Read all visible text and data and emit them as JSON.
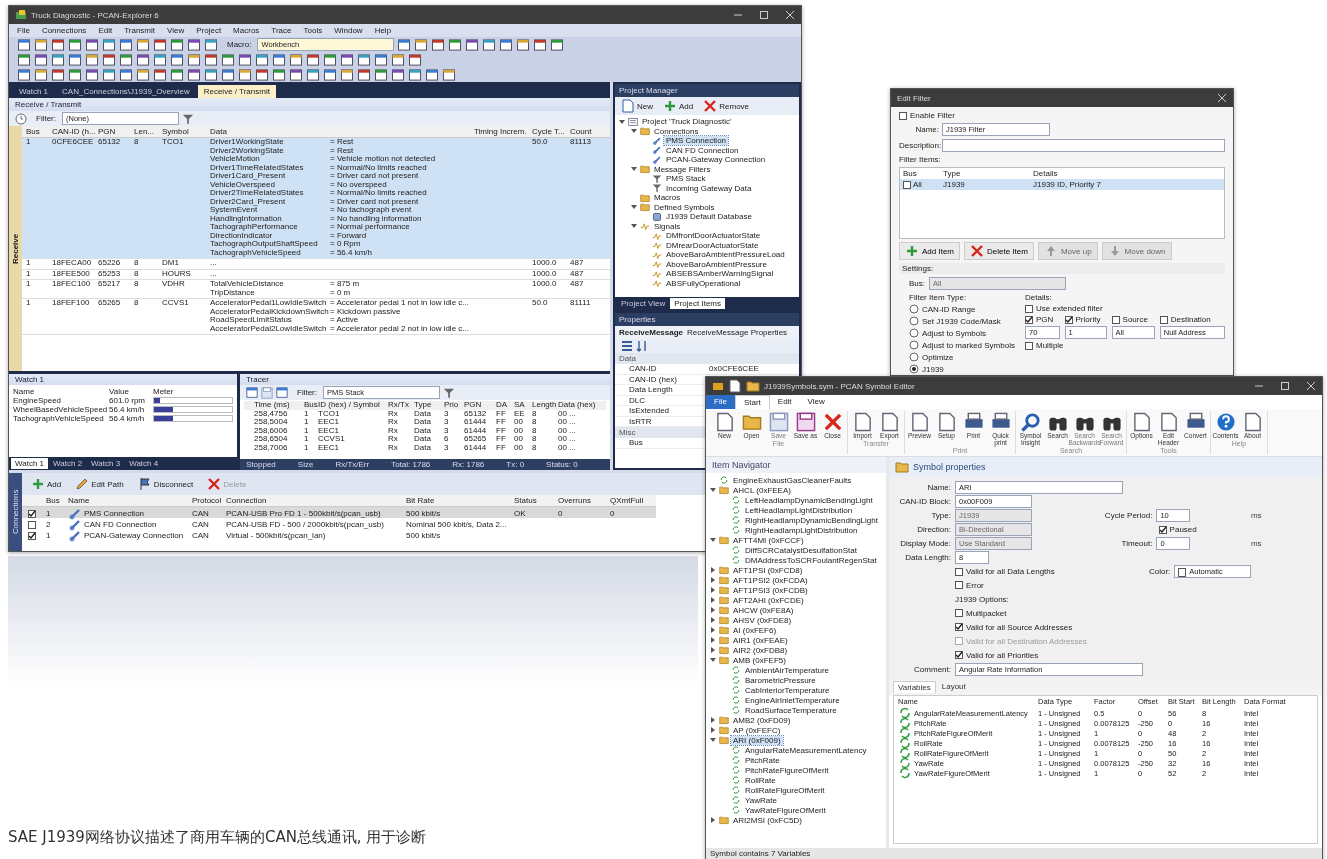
{
  "main_window": {
    "title": "Truck Diagnostic - PCAN-Explorer 6",
    "menu": [
      "File",
      "Connections",
      "Edit",
      "Transmit",
      "View",
      "Project",
      "Macros",
      "Trace",
      "Tools",
      "Window",
      "Help"
    ],
    "toolbar_combo": {
      "label": "Macro:",
      "value": "Workbench"
    },
    "doc_tabs": [
      {
        "label": "Watch 1",
        "selected": false
      },
      {
        "label": "CAN_Connections\\J1939_Overview",
        "selected": false
      },
      {
        "label": "Receive / Transmit",
        "selected": true
      }
    ],
    "receive": {
      "title": "Receive / Transmit",
      "filter_label": "Filter:",
      "filter_value": "(None)",
      "side_label": "Receive",
      "columns": [
        "Bus",
        "CAN-ID (h...",
        "PGN",
        "Len...",
        "Symbol",
        "Data",
        "Timing Increm.",
        "Cycle T...",
        "Count"
      ],
      "rows": [
        {
          "selected": true,
          "cells": [
            "1",
            "0CFE6CEE",
            "65132",
            "8",
            "TCO1"
          ],
          "data": [
            {
              "name": "Driver1WorkingState",
              "value": "= Rest"
            },
            {
              "name": "Driver2WorkingState",
              "value": "= Rest"
            },
            {
              "name": "VehicleMotion",
              "value": "= Vehicle motion not detected"
            },
            {
              "name": "Driver1TimeRelatedStates",
              "value": "= Normal/No limits reached"
            },
            {
              "name": "Driver1Card_Present",
              "value": "= Driver card not present"
            },
            {
              "name": "VehicleOverspeed",
              "value": "= No overspeed"
            },
            {
              "name": "Driver2TimeRelatedStates",
              "value": "= Normal/No limits reached"
            },
            {
              "name": "Driver2Card_Present",
              "value": "= Driver card not present"
            },
            {
              "name": "SystemEvent",
              "value": "= No tachograph event"
            },
            {
              "name": "HandlingInformation",
              "value": "= No handling information"
            },
            {
              "name": "TachographPerformance",
              "value": "= Normal performance"
            },
            {
              "name": "DirectionIndicator",
              "value": "= Forward"
            },
            {
              "name": "TachographOutputShaftSpeed",
              "value": "= 0 Rpm"
            },
            {
              "name": "TachographVehicleSpeed",
              "value": "= 56.4 km/h"
            }
          ],
          "tail": [
            "50.0",
            "81113"
          ]
        },
        {
          "selected": false,
          "cells": [
            "1",
            "18FECA00",
            "65226",
            "8",
            "DM1"
          ],
          "data": [
            {
              "name": "..."
            }
          ],
          "tail": [
            "1000.0",
            "487"
          ]
        },
        {
          "selected": false,
          "cells": [
            "1",
            "18FEE500",
            "65253",
            "8",
            "HOURS"
          ],
          "data": [
            {
              "name": "..."
            }
          ],
          "tail": [
            "1000.0",
            "487"
          ]
        },
        {
          "selected": false,
          "cells": [
            "1",
            "18FEC100",
            "65217",
            "8",
            "VDHR"
          ],
          "data": [
            {
              "name": "TotalVehicleDistance",
              "value": "= 875 m"
            },
            {
              "name": "TripDistance",
              "value": "= 0 m"
            }
          ],
          "tail": [
            "1000.0",
            "487"
          ]
        },
        {
          "selected": false,
          "cells": [
            "1",
            "18FEF100",
            "65265",
            "8",
            "CCVS1"
          ],
          "data": [
            {
              "name": "AcceleratorPedal1LowIdleSwitch",
              "value": "= Accelerator pedal 1 not in low idle c..."
            },
            {
              "name": "AcceleratorPedalKickdownSwitch",
              "value": "= Kickdown passive"
            },
            {
              "name": "RoadSpeedLimitStatus",
              "value": "= Active"
            },
            {
              "name": "AcceleratorPedal2LowIdleSwitch",
              "value": "= Accelerator pedal 2 not in low idle c..."
            }
          ],
          "tail": [
            "50.0",
            "81111"
          ]
        }
      ]
    },
    "watch": {
      "title": "Watch 1",
      "columns": [
        "Name",
        "Value",
        "Meter"
      ],
      "rows": [
        {
          "name": "EngineSpeed",
          "value": "601.0 rpm",
          "level": 0.08
        },
        {
          "name": "WheelBasedVehicleSpeed",
          "value": "56.4 km/h",
          "level": 0.24
        },
        {
          "name": "TachographVehicleSpeed",
          "value": "56.4 km/h",
          "level": 0.24
        }
      ],
      "tabs": [
        {
          "label": "Watch 1",
          "selected": true
        },
        {
          "label": "Watch 2",
          "selected": false
        },
        {
          "label": "Watch 3",
          "selected": false
        },
        {
          "label": "Watch 4",
          "selected": false
        }
      ]
    },
    "trace": {
      "title": "Tracer",
      "filter_label": "Filter:",
      "filter_value": "PMS Stack",
      "columns": [
        "Time (ms)",
        "Bus",
        "ID (hex) / Symbol",
        "Rx/Tx",
        "Type",
        "Prio",
        "PGN",
        "DA",
        "SA",
        "Length",
        "Data (hex)"
      ],
      "rows": [
        [
          "258,4756",
          "1",
          "TCO1",
          "Rx",
          "Data",
          "3",
          "65132",
          "FF",
          "EE",
          "8",
          "00 ..."
        ],
        [
          "258,5004",
          "1",
          "EEC1",
          "Rx",
          "Data",
          "3",
          "61444",
          "FF",
          "00",
          "8",
          "00 ..."
        ],
        [
          "258,6006",
          "1",
          "EEC1",
          "Rx",
          "Data",
          "3",
          "61444",
          "FF",
          "00",
          "8",
          "00 ..."
        ],
        [
          "258,6504",
          "1",
          "CCVS1",
          "Rx",
          "Data",
          "6",
          "65265",
          "FF",
          "00",
          "8",
          "00 ..."
        ],
        [
          "258,7006",
          "1",
          "EEC1",
          "Rx",
          "Data",
          "3",
          "61444",
          "FF",
          "00",
          "8",
          "00 ..."
        ]
      ],
      "status": [
        "Stopped",
        "Size",
        "Rx/Tx/Err",
        "Total: 1786",
        "Rx: 1786",
        "Tx: 0",
        "Status: 0"
      ]
    },
    "project_manager": {
      "title": "Project Manager",
      "buttons": [
        {
          "label": "New",
          "kind": "new"
        },
        {
          "label": "Add",
          "kind": "add"
        },
        {
          "label": "Remove",
          "kind": "remove"
        }
      ],
      "tree": [
        {
          "label": "Project 'Truck Diagnostic'",
          "kind": "project",
          "expanded": true,
          "children": [
            {
              "label": "Connections",
              "kind": "folder",
              "expanded": true,
              "children": [
                {
                  "label": "PMS Connection",
                  "kind": "link",
                  "selected": true
                },
                {
                  "label": "CAN FD Connection",
                  "kind": "link",
                  "selected": false
                },
                {
                  "label": "PCAN-Gateway Connection",
                  "kind": "link",
                  "selected": false
                }
              ]
            },
            {
              "label": "Message Filters",
              "kind": "folder",
              "expanded": true,
              "children": [
                {
                  "label": "PMS Stack",
                  "kind": "filter",
                  "selected": false
                },
                {
                  "label": "Incoming Gateway Data",
                  "kind": "filter",
                  "selected": false
                }
              ]
            },
            {
              "label": "Macros",
              "kind": "folder",
              "selected": false
            },
            {
              "label": "Defined Symbols",
              "kind": "folder",
              "expanded": true,
              "children": [
                {
                  "label": "J1939 Default Database",
                  "kind": "db",
                  "selected": false
                }
              ]
            },
            {
              "label": "Signals",
              "kind": "signal",
              "expanded": true,
              "children": [
                {
                  "label": "DMfrontDoorActuatorState",
                  "kind": "signal",
                  "selected": false
                },
                {
                  "label": "DMrearDoorActuatorState",
                  "kind": "signal",
                  "selected": false
                },
                {
                  "label": "AboveBaroAmbientPressureLoad",
                  "kind": "signal",
                  "selected": false
                },
                {
                  "label": "AboveBaroAmbientPressure",
                  "kind": "signal",
                  "selected": false
                },
                {
                  "label": "ABSEBSAmberWarningSignal",
                  "kind": "signal",
                  "selected": false
                },
                {
                  "label": "ABSFullyOperational",
                  "kind": "signal",
                  "selected": false
                }
              ]
            }
          ]
        }
      ],
      "tabs": [
        {
          "label": "Project View",
          "selected": false
        },
        {
          "label": "Project Items",
          "selected": true
        }
      ]
    },
    "properties": {
      "title": "Properties",
      "object": "ReceiveMessage",
      "object_type": "ReceiveMessage Properties",
      "groups": [
        {
          "name": "Data",
          "rows": [
            {
              "name": "CAN-ID",
              "value": "0x0CFE6CEE"
            },
            {
              "name": "CAN-ID (hex)"
            },
            {
              "name": "Data Length"
            },
            {
              "name": "DLC"
            },
            {
              "name": "IsExtended"
            },
            {
              "name": "IsRTR"
            }
          ]
        },
        {
          "name": "Misc",
          "rows": [
            {
              "name": "Bus"
            }
          ]
        }
      ]
    },
    "connections": {
      "side_label": "Connections",
      "buttons": [
        {
          "label": "Add",
          "kind": "add",
          "disabled": false
        },
        {
          "label": "Edit Path",
          "kind": "edit",
          "disabled": false
        },
        {
          "label": "Disconnect",
          "kind": "disconnect",
          "disabled": false
        },
        {
          "label": "Delete",
          "kind": "remove",
          "disabled": true
        }
      ],
      "columns": [
        "Bus",
        "Name",
        "Protocol",
        "Connection",
        "Bit Rate",
        "Status",
        "Overruns",
        "QXmtFull"
      ],
      "rows": [
        {
          "checked": true,
          "selected": true,
          "cells": [
            "1",
            "PMS Connection",
            "CAN",
            "PCAN-USB Pro FD 1 - 500kbit/s(pcan_usb)",
            "500 kbit/s",
            "OK",
            "0",
            "0"
          ]
        },
        {
          "checked": false,
          "selected": false,
          "cells": [
            "2",
            "CAN FD Connection",
            "CAN",
            "PCAN-USB FD - 500 / 2000kbit/s(pcan_usb)",
            "Nominal 500 kbit/s, Data 2...",
            "",
            "",
            ""
          ]
        },
        {
          "checked": true,
          "selected": false,
          "cells": [
            "1",
            "PCAN-Gateway Connection",
            "CAN",
            "Virtual - 500kbit/s(pcan_lan)",
            "500 kbit/s",
            "",
            "",
            ""
          ]
        }
      ]
    }
  },
  "edit_filter": {
    "title": "Edit Filter",
    "enable": {
      "label": "Enable Filter",
      "checked": false
    },
    "name": {
      "label": "Name:",
      "value": "J1939 Filter"
    },
    "description": {
      "label": "Description:"
    },
    "items_label": "Filter Items:",
    "columns": [
      "Bus",
      "Type",
      "Details"
    ],
    "items": [
      {
        "checked": false,
        "selected": true,
        "cells": [
          "All",
          "J1939",
          "J1939 ID, Priority 7"
        ]
      }
    ],
    "buttons": [
      {
        "label": "Add Item",
        "kind": "add",
        "disabled": false
      },
      {
        "label": "Delete Item",
        "kind": "remove",
        "disabled": false
      },
      {
        "label": "Move up",
        "kind": "up",
        "disabled": true
      },
      {
        "label": "Move down",
        "kind": "down",
        "disabled": true
      }
    ],
    "settings_label": "Settings:",
    "bus": {
      "label": "Bus:",
      "value": "All"
    },
    "type_label": "Filter Item Type:",
    "types": [
      {
        "label": "CAN-ID Range",
        "selected": false
      },
      {
        "label": "Set J1939 Code/Mask",
        "selected": false
      },
      {
        "label": "Adjust to Symbols",
        "selected": false
      },
      {
        "label": "Adjust to marked Symbols",
        "selected": false
      },
      {
        "label": "Optimize",
        "selected": false
      },
      {
        "label": "J1939",
        "selected": true
      }
    ],
    "details_label": "Details:",
    "extended": {
      "label": "Use extended filter",
      "checked": false
    },
    "checks": [
      {
        "label": "PGN",
        "checked": true
      },
      {
        "label": "Priority",
        "checked": true
      },
      {
        "label": "Source",
        "checked": false
      },
      {
        "label": "Destination",
        "checked": false
      }
    ],
    "values": [
      "70",
      "1",
      "All",
      "Null Address"
    ],
    "multiple": {
      "label": "Multiple",
      "checked": false
    }
  },
  "symbol_editor": {
    "title": "J1939Symbols.sym - PCAN Symbol Editor",
    "tabs": [
      {
        "label": "File",
        "selected": false,
        "kind": "file"
      },
      {
        "label": "Start",
        "selected": true,
        "kind": "tab"
      },
      {
        "label": "Edit",
        "selected": false,
        "kind": "tab"
      },
      {
        "label": "View",
        "selected": false,
        "kind": "tab"
      }
    ],
    "groups": [
      {
        "name": "File",
        "buttons": [
          {
            "label": "New",
            "kind": "doc",
            "disabled": false
          },
          {
            "label": "Open",
            "kind": "folder",
            "disabled": false
          },
          {
            "label": "Save",
            "kind": "save",
            "disabled": true
          },
          {
            "label": "Save as",
            "kind": "saveas",
            "disabled": false
          },
          {
            "label": "Close",
            "kind": "close",
            "disabled": false
          }
        ]
      },
      {
        "name": "Transfer",
        "buttons": [
          {
            "label": "Import",
            "kind": "doc",
            "disabled": false
          },
          {
            "label": "Export",
            "kind": "doc",
            "disabled": false
          }
        ]
      },
      {
        "name": "Print",
        "buttons": [
          {
            "label": "Preview",
            "kind": "doc",
            "disabled": false
          },
          {
            "label": "Setup",
            "kind": "doc",
            "disabled": false
          },
          {
            "label": "Print",
            "kind": "printer",
            "disabled": false
          },
          {
            "label": "Quick print",
            "kind": "printer",
            "disabled": false
          }
        ]
      },
      {
        "name": "Search",
        "buttons": [
          {
            "label": "Symbol Insight",
            "kind": "search",
            "disabled": false
          },
          {
            "label": "Search",
            "kind": "binoculars",
            "disabled": false
          },
          {
            "label": "Search Backwards",
            "kind": "binoculars",
            "disabled": true
          },
          {
            "label": "Search Forward",
            "kind": "binoculars",
            "disabled": true
          }
        ]
      },
      {
        "name": "Tools",
        "buttons": [
          {
            "label": "Options",
            "kind": "doc",
            "disabled": false
          },
          {
            "label": "Edit Header",
            "kind": "doc",
            "disabled": false
          },
          {
            "label": "Convert",
            "kind": "printer",
            "disabled": false
          }
        ]
      },
      {
        "name": "Help",
        "buttons": [
          {
            "label": "Contents",
            "kind": "help",
            "disabled": false
          },
          {
            "label": "About",
            "kind": "doc",
            "disabled": false
          }
        ]
      }
    ],
    "navigator_title": "Item Navigator",
    "tree": [
      {
        "label": "EngineExhaustGasCleanerFaults",
        "kind": "symbol",
        "selected": false
      },
      {
        "label": "AHCL (0xFEEA)",
        "kind": "folder",
        "expanded": true,
        "children": [
          {
            "label": "LeftHeadlampDynamicBendingLight",
            "kind": "symbol",
            "selected": false
          },
          {
            "label": "LeftHeadlampLightDistribution",
            "kind": "symbol",
            "selected": false
          },
          {
            "label": "RightHeadlampDynamicBendingLight",
            "kind": "symbol",
            "selected": false
          },
          {
            "label": "RightHeadlampLightDistribution",
            "kind": "symbol",
            "selected": false
          }
        ]
      },
      {
        "label": "AFTT4MI (0xFCCF)",
        "kind": "folder",
        "expanded": true,
        "children": [
          {
            "label": "DiffSCRCatalystDesulfationStat",
            "kind": "symbol",
            "selected": false
          },
          {
            "label": "DMAddressToSCRFoulantRegenStat",
            "kind": "symbol",
            "selected": false
          }
        ]
      },
      {
        "label": "AFT1PSI (0xFCD8)",
        "kind": "folder",
        "expanded": false
      },
      {
        "label": "AFT1PSI2 (0xFCDA)",
        "kind": "folder",
        "expanded": false
      },
      {
        "label": "AFT1PSI3 (0xFCDB)",
        "kind": "folder",
        "expanded": false
      },
      {
        "label": "AFT2AHI (0xFCDE)",
        "kind": "folder",
        "expanded": false
      },
      {
        "label": "AHCW (0xFE8A)",
        "kind": "folder",
        "expanded": false
      },
      {
        "label": "AHSV (0xFDE8)",
        "kind": "folder",
        "expanded": false
      },
      {
        "label": "AI (0xFEF6)",
        "kind": "folder",
        "expanded": false
      },
      {
        "label": "AIR1 (0xFEAE)",
        "kind": "folder",
        "expanded": false
      },
      {
        "label": "AIR2 (0xFDB8)",
        "kind": "folder",
        "expanded": false
      },
      {
        "label": "AMB (0xFEF5)",
        "kind": "folder",
        "expanded": true,
        "children": [
          {
            "label": "AmbientAirTemperature",
            "kind": "symbol",
            "selected": false
          },
          {
            "label": "BarometricPressure",
            "kind": "symbol",
            "selected": false
          },
          {
            "label": "CabInteriorTemperature",
            "kind": "symbol",
            "selected": false
          },
          {
            "label": "EngineAirInletTemperature",
            "kind": "symbol",
            "selected": false
          },
          {
            "label": "RoadSurfaceTemperature",
            "kind": "symbol",
            "selected": false
          }
        ]
      },
      {
        "label": "AMB2 (0xFD09)",
        "kind": "folder",
        "expanded": false
      },
      {
        "label": "AP (0xFEFC)",
        "kind": "folder",
        "expanded": false
      },
      {
        "label": "ARI (0xF009)",
        "kind": "folder",
        "expanded": true,
        "selected": true,
        "children": [
          {
            "label": "AngularRateMeasurementLatency",
            "kind": "symbol",
            "selected": false
          },
          {
            "label": "PitchRate",
            "kind": "symbol",
            "selected": false
          },
          {
            "label": "PitchRateFigureOfMerit",
            "kind": "symbol",
            "selected": false
          },
          {
            "label": "RollRate",
            "kind": "symbol",
            "selected": false
          },
          {
            "label": "RollRateFigureOfMerit",
            "kind": "symbol",
            "selected": false
          },
          {
            "label": "YawRate",
            "kind": "symbol",
            "selected": false
          },
          {
            "label": "YawRateFigureOfMerit",
            "kind": "symbol",
            "selected": false
          }
        ]
      },
      {
        "label": "ARI2MSI (0xFC5D)",
        "kind": "folder",
        "expanded": false
      }
    ],
    "props_title": "Symbol properties",
    "name": {
      "label": "Name:",
      "value": "ARI"
    },
    "canid": {
      "label": "CAN-ID Block:",
      "value": "0x00F009"
    },
    "type": {
      "label": "Type:",
      "value": "J1939"
    },
    "direction": {
      "label": "Direction:",
      "value": "Bi-Directional"
    },
    "display": {
      "label": "Display Mode:",
      "value": "Use Standard"
    },
    "length": {
      "label": "Data Length:",
      "value": "8"
    },
    "cycle": {
      "label": "Cycle Period:",
      "value": "10",
      "unit": "ms"
    },
    "paused": {
      "label": "Paused",
      "checked": true
    },
    "timeout": {
      "label": "Timeout:",
      "value": "0",
      "unit": "ms"
    },
    "color": {
      "label": "Color:",
      "value": "Automatic"
    },
    "checks": [
      {
        "label": "Valid for all Data Lengths",
        "checked": false,
        "disabled": false
      },
      {
        "label": "Error",
        "checked": false,
        "disabled": false
      }
    ],
    "j1939_label": "J1939 Options:",
    "j1939_checks": [
      {
        "label": "Multipacket",
        "checked": false,
        "disabled": false
      },
      {
        "label": "Valid for all Source Addresses",
        "checked": true,
        "disabled": false
      },
      {
        "label": "Valid for all Destination Addresses",
        "checked": false,
        "disabled": true
      },
      {
        "label": "Valid for all Priorities",
        "checked": true,
        "disabled": false
      }
    ],
    "comment": {
      "label": "Comment:",
      "value": "Angular Rate Information"
    },
    "var_tabs": [
      {
        "label": "Variables",
        "selected": true
      },
      {
        "label": "Layout",
        "selected": false
      }
    ],
    "var_columns": [
      "Name",
      "Data Type",
      "Factor",
      "Offset",
      "Bit Start",
      "Bit Length",
      "Data Format"
    ],
    "variables": [
      [
        "AngularRateMeasurementLatency",
        "1 - Unsigned",
        "0.5",
        "0",
        "56",
        "8",
        "Intel"
      ],
      [
        "PitchRate",
        "1 - Unsigned",
        "0.0078125",
        "-250",
        "0",
        "16",
        "Intel"
      ],
      [
        "PitchRateFigureOfMerit",
        "1 - Unsigned",
        "1",
        "0",
        "48",
        "2",
        "Intel"
      ],
      [
        "RollRate",
        "1 - Unsigned",
        "0.0078125",
        "-250",
        "16",
        "16",
        "Intel"
      ],
      [
        "RollRateFigureOfMerit",
        "1 - Unsigned",
        "1",
        "0",
        "50",
        "2",
        "Intel"
      ],
      [
        "YawRate",
        "1 - Unsigned",
        "0.0078125",
        "-250",
        "32",
        "16",
        "Intel"
      ],
      [
        "YawRateFigureOfMerit",
        "1 - Unsigned",
        "1",
        "0",
        "52",
        "2",
        "Intel"
      ]
    ],
    "status": "Symbol contains 7 Variables"
  },
  "caption": "SAE J1939网络协议描述了商用车辆的CAN总线通讯, 用于诊断"
}
